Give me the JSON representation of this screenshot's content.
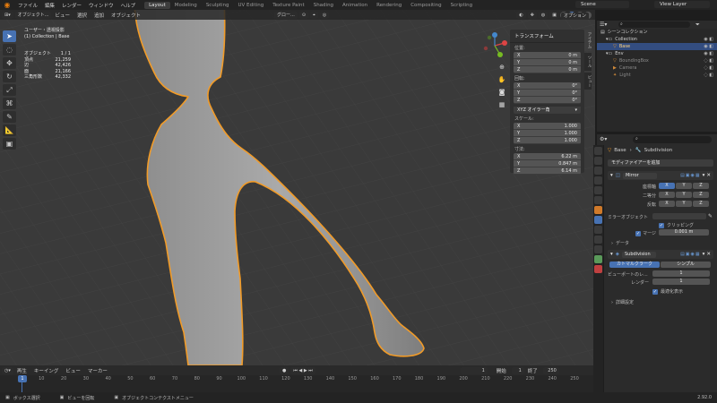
{
  "top_menu": {
    "items": [
      "ファイル",
      "編集",
      "レンダー",
      "ウィンドウ",
      "ヘルプ"
    ],
    "workspaces": [
      "Layout",
      "Modeling",
      "Sculpting",
      "UV Editing",
      "Texture Paint",
      "Shading",
      "Animation",
      "Rendering",
      "Compositing",
      "Scripting"
    ],
    "active_workspace": "Layout",
    "scene": "Scene",
    "view_layer": "View Layer"
  },
  "viewport_header": {
    "mode": "オブジェクト...",
    "menus": [
      "ビュー",
      "選択",
      "追加",
      "オブジェクト"
    ],
    "orientation": "グロー...",
    "options": "オプション"
  },
  "overlay": {
    "view_name": "ユーザー・透視投影",
    "collection": "(1) Collection | Base",
    "stats": [
      {
        "label": "オブジェクト",
        "value": "1 / 1"
      },
      {
        "label": "頂点",
        "value": "21,259"
      },
      {
        "label": "辺",
        "value": "42,426"
      },
      {
        "label": "面",
        "value": "21,166"
      },
      {
        "label": "三角形数",
        "value": "42,332"
      }
    ]
  },
  "npanel": {
    "title": "トランスフォーム",
    "location_label": "位置:",
    "location": [
      {
        "axis": "X",
        "value": "0 m"
      },
      {
        "axis": "Y",
        "value": "0 m"
      },
      {
        "axis": "Z",
        "value": "0 m"
      }
    ],
    "rotation_label": "回転:",
    "rotation": [
      {
        "axis": "X",
        "value": "0°"
      },
      {
        "axis": "Y",
        "value": "0°"
      },
      {
        "axis": "Z",
        "value": "0°"
      }
    ],
    "rotation_mode": "XYZ オイラー角",
    "scale_label": "スケール:",
    "scale": [
      {
        "axis": "X",
        "value": "1.000"
      },
      {
        "axis": "Y",
        "value": "1.000"
      },
      {
        "axis": "Z",
        "value": "1.000"
      }
    ],
    "dimensions_label": "寸法:",
    "dimensions": [
      {
        "axis": "X",
        "value": "6.22 m"
      },
      {
        "axis": "Y",
        "value": "0.847 m"
      },
      {
        "axis": "Z",
        "value": "6.14 m"
      }
    ],
    "tabs": [
      "アイテム",
      "ツール",
      "ビュー"
    ]
  },
  "outliner": {
    "header": "シーンコレクション",
    "items": [
      {
        "name": "Collection",
        "depth": 0,
        "selected": false
      },
      {
        "name": "Base",
        "depth": 1,
        "selected": true
      },
      {
        "name": "Env",
        "depth": 0,
        "selected": false
      },
      {
        "name": "BoundingBox",
        "depth": 1,
        "selected": false
      },
      {
        "name": "Camera",
        "depth": 1,
        "selected": false
      },
      {
        "name": "Light",
        "depth": 1,
        "selected": false
      }
    ]
  },
  "properties": {
    "object_name": "Base",
    "modifier_name": "Subdivision",
    "add_modifier": "モディファイアーを追加",
    "mirror": {
      "name": "Mirror",
      "axis_label": "座標軸",
      "bisect_label": "二等分",
      "flip_label": "反転",
      "axes": [
        "X",
        "Y",
        "Z"
      ],
      "mirror_object_label": "ミラーオブジェクト",
      "clipping_label": "クリッピング",
      "merge_label": "マージ",
      "merge_value": "0.001 m",
      "data_label": "データ"
    },
    "subdivision": {
      "name": "Subdivision",
      "type_catmull": "カトマルクラーク",
      "type_simple": "シンプル",
      "viewport_label": "ビューポートのレ...",
      "viewport_value": "1",
      "render_label": "レンダー",
      "render_value": "1",
      "optimal_label": "最適化表示",
      "advanced_label": "詳細設定"
    }
  },
  "timeline": {
    "menus": [
      "再生",
      "キーイング",
      "ビュー",
      "マーカー"
    ],
    "current_frame": "1",
    "start_label": "開始",
    "start_value": "1",
    "end_label": "終了",
    "end_value": "250",
    "ticks": [
      "1",
      "10",
      "20",
      "30",
      "40",
      "50",
      "60",
      "70",
      "80",
      "90",
      "100",
      "110",
      "120",
      "130",
      "140",
      "150",
      "160",
      "170",
      "180",
      "190",
      "200",
      "210",
      "220",
      "230",
      "240",
      "250"
    ]
  },
  "statusbar": {
    "items": [
      "ボックス選択",
      "ビューを回転",
      "オブジェクトコンテクストメニュー"
    ],
    "version": "2.92.0"
  },
  "colors": {
    "accent": "#4772b3",
    "selection_outline": "#f19b28",
    "viewport_bg": "#3a3a3a"
  }
}
